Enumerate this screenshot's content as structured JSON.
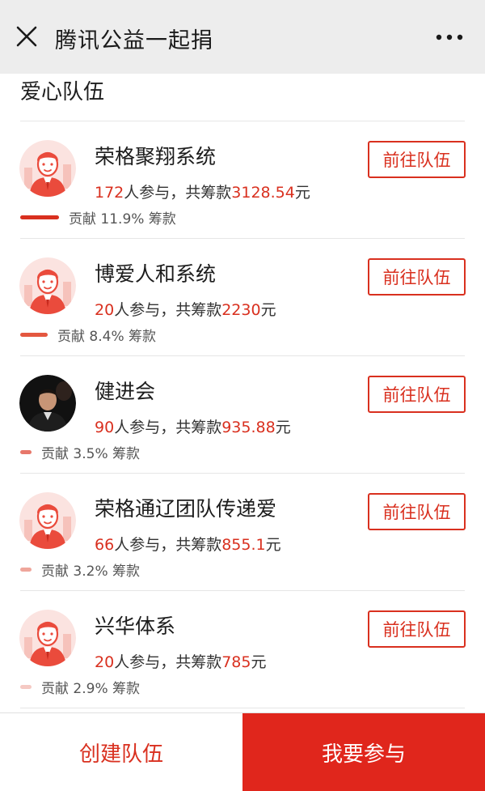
{
  "header": {
    "title": "腾讯公益一起捐",
    "close_icon": "close-icon",
    "more_icon": "more-dots-icon"
  },
  "section": {
    "title": "爱心队伍"
  },
  "teams": [
    {
      "name": "荣格聚翔系统",
      "count": "172",
      "count_suffix": "人参与，共筹款",
      "amount": "3128.54",
      "unit": "元",
      "contribution": "贡献 11.9% 筹款",
      "share": 0.119,
      "bar_color": "#d9301f",
      "avatar": "red-person-avatar",
      "button": "前往队伍"
    },
    {
      "name": "博爱人和系统",
      "count": "20",
      "count_suffix": "人参与，共筹款",
      "amount": "2230",
      "unit": "元",
      "contribution": "贡献 8.4% 筹款",
      "share": 0.084,
      "bar_color": "#e4573f",
      "avatar": "red-person-avatar",
      "button": "前往队伍"
    },
    {
      "name": "健进会",
      "count": "90",
      "count_suffix": "人参与，共筹款",
      "amount": "935.88",
      "unit": "元",
      "contribution": "贡献 3.5% 筹款",
      "share": 0.035,
      "bar_color": "#e7776a",
      "avatar": "photo-avatar",
      "button": "前往队伍"
    },
    {
      "name": "荣格通辽团队传递爱",
      "count": "66",
      "count_suffix": "人参与，共筹款",
      "amount": "855.1",
      "unit": "元",
      "contribution": "贡献 3.2% 筹款",
      "share": 0.032,
      "bar_color": "#efa69b",
      "avatar": "red-person-avatar",
      "button": "前往队伍"
    },
    {
      "name": "兴华体系",
      "count": "20",
      "count_suffix": "人参与，共筹款",
      "amount": "785",
      "unit": "元",
      "contribution": "贡献 2.9% 筹款",
      "share": 0.029,
      "bar_color": "#f5c9c3",
      "avatar": "red-person-avatar",
      "button": "前往队伍"
    }
  ],
  "footer": {
    "create_label": "创建队伍",
    "join_label": "我要参与"
  },
  "colors": {
    "accent": "#d9301f",
    "join_bg": "#e0261c",
    "topbar_bg": "#ededed"
  }
}
